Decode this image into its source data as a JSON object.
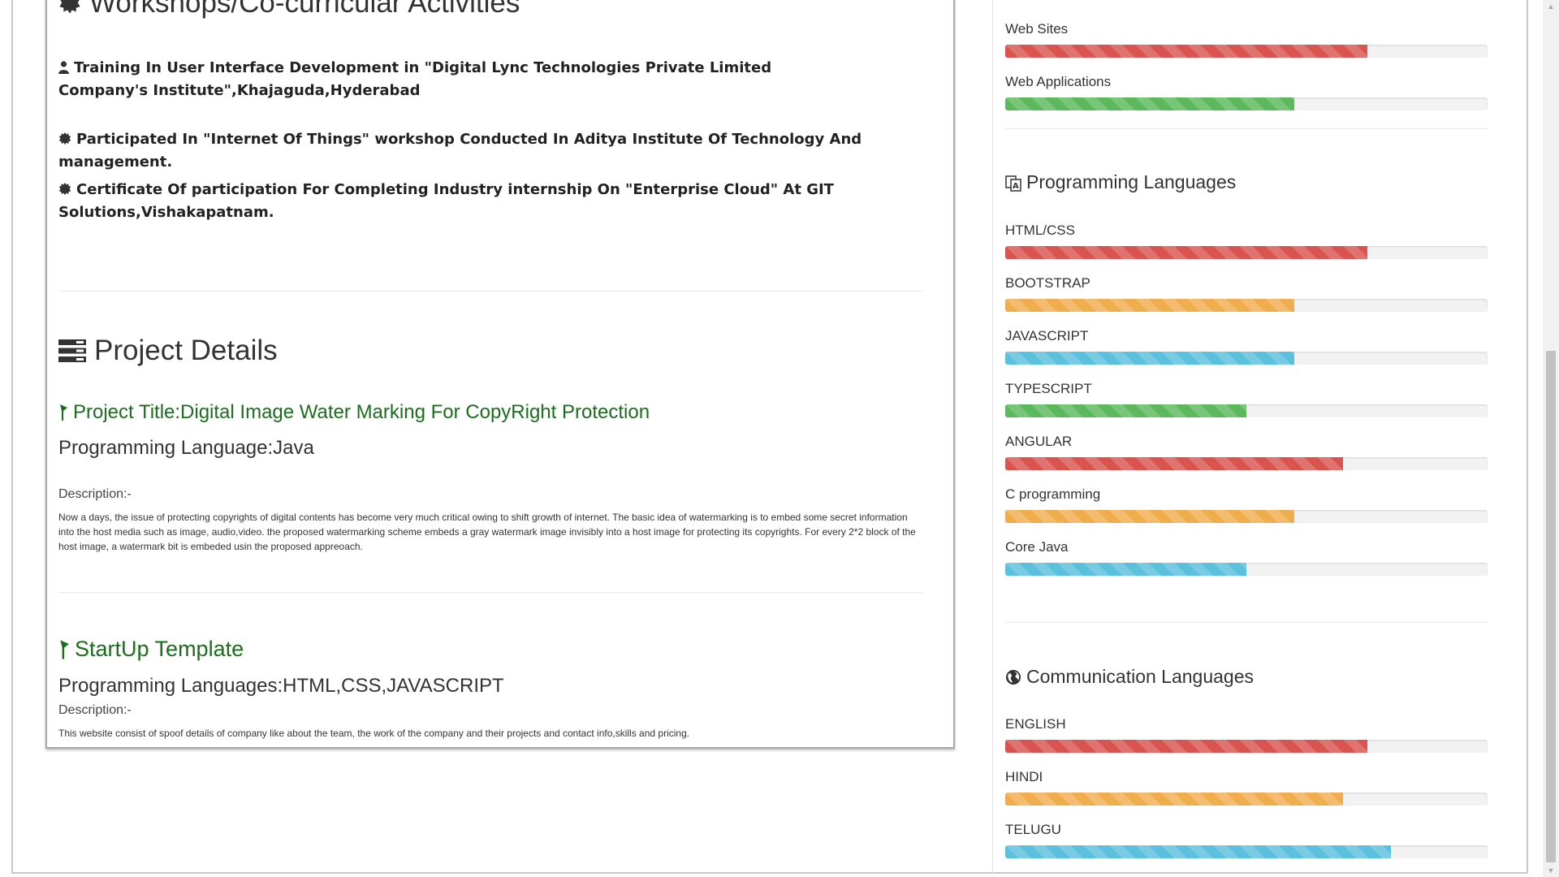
{
  "activities": {
    "heading": "Workshops/Co-curricular Activities",
    "items": [
      {
        "text": "Training In User Interface Development in \"Digital Lync Technologies Private Limited Company's Institute\",Khajaguda,Hyderabad",
        "icon": "user-icon"
      },
      {
        "text": "Participated In \"Internet Of Things\" workshop Conducted In Aditya Institute Of Technology And management.",
        "icon": "certificate-icon"
      },
      {
        "text": "Certificate Of participation For Completing Industry internship On \"Enterprise Cloud\" At GIT Solutions,Vishakapatnam.",
        "icon": "certificate-icon"
      }
    ]
  },
  "projects": {
    "heading": "Project Details",
    "items": [
      {
        "title": "Project Title:Digital Image Water Marking For CopyRight Protection",
        "language": "Programming Language:Java",
        "desc_label": "Description:-",
        "description": "Now a days, the issue of protecting copyrights of digital contents has become very much critical owing to shift growth of internet. The basic idea of watermarking is to embed some secret information into the host media such as image, audio,video. the proposed watermarking scheme embeds a gray watermark image invisibly into a host image for protecting its copyrights. For every 2*2 block of the host image, a watermark bit is embeded usin the proposed appreoach."
      },
      {
        "title": "StartUp Template",
        "language": "Programming Languages:HTML,CSS,JAVASCRIPT",
        "desc_label": "Description:-",
        "description": "This website consist of spoof details of company like about the team, the work of the company and their projects and contact info,skills and pricing."
      }
    ]
  },
  "skills": {
    "web": [
      {
        "label": "Web Sites",
        "level": 0.75,
        "color": "#d9534f"
      },
      {
        "label": "Web Applications",
        "level": 0.6,
        "color": "#5cb85c"
      }
    ],
    "programming_heading": "Programming Languages",
    "programming": [
      {
        "label": "HTML/CSS",
        "level": 0.75,
        "color": "#d9534f"
      },
      {
        "label": "BOOTSTRAP",
        "level": 0.6,
        "color": "#f0ad4e"
      },
      {
        "label": "JAVASCRIPT",
        "level": 0.6,
        "color": "#5bc0de"
      },
      {
        "label": "TYPESCRIPT",
        "level": 0.5,
        "color": "#5cb85c"
      },
      {
        "label": "ANGULAR",
        "level": 0.7,
        "color": "#d9534f"
      },
      {
        "label": "C programming",
        "level": 0.6,
        "color": "#f0ad4e"
      },
      {
        "label": "Core Java",
        "level": 0.5,
        "color": "#5bc0de"
      }
    ],
    "communication_heading": "Communication Languages",
    "communication": [
      {
        "label": "ENGLISH",
        "level": 0.75,
        "color": "#d9534f"
      },
      {
        "label": "HINDI",
        "level": 0.7,
        "color": "#f0ad4e"
      },
      {
        "label": "TELUGU",
        "level": 0.8,
        "color": "#5bc0de"
      }
    ]
  }
}
